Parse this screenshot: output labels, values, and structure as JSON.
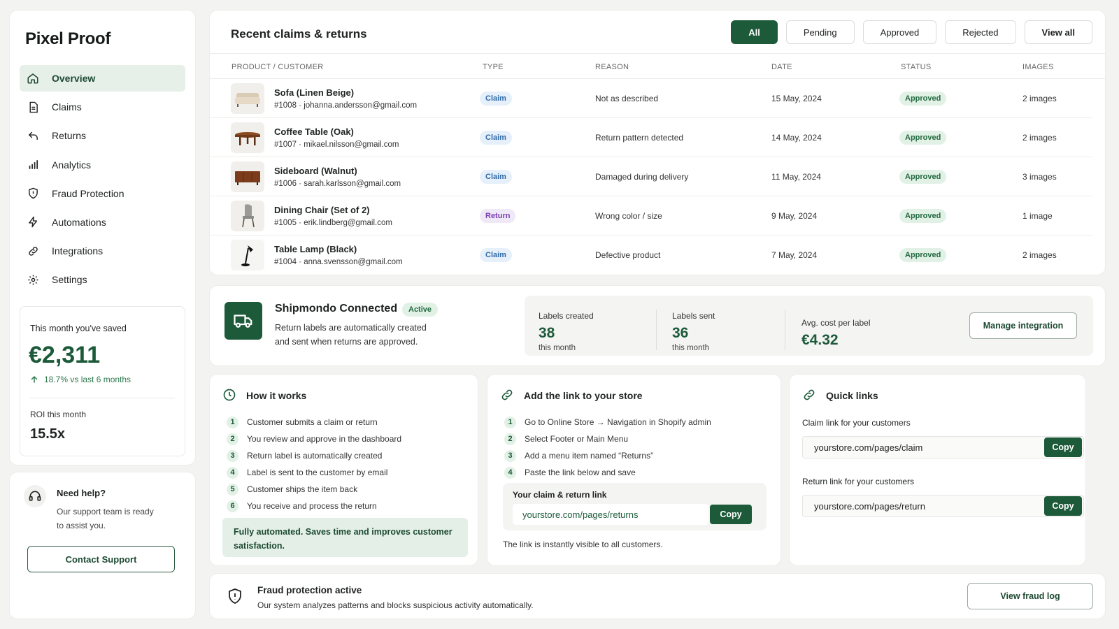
{
  "app": {
    "name": "Pixel Proof"
  },
  "sidebar": {
    "items": [
      {
        "label": "Overview",
        "icon": "home-icon"
      },
      {
        "label": "Claims",
        "icon": "document-icon"
      },
      {
        "label": "Returns",
        "icon": "return-arrow-icon"
      },
      {
        "label": "Analytics",
        "icon": "bar-chart-icon"
      },
      {
        "label": "Fraud Protection",
        "icon": "shield-icon"
      },
      {
        "label": "Automations",
        "icon": "lightning-icon"
      },
      {
        "label": "Integrations",
        "icon": "link-icon"
      },
      {
        "label": "Settings",
        "icon": "gear-icon"
      }
    ],
    "savings": {
      "label": "This month you've saved",
      "amount": "€2,311",
      "trend": "18.7% vs last 6 months",
      "roi_label": "ROI this month",
      "roi_value": "15.5x"
    },
    "help": {
      "title": "Need help?",
      "text": "Our support team is ready to assist you.",
      "button": "Contact Support"
    }
  },
  "claims": {
    "title": "Recent claims & returns",
    "filters": [
      "All",
      "Pending",
      "Approved",
      "Rejected"
    ],
    "view_all": "View all",
    "columns": [
      "Product / Customer",
      "Type",
      "Reason",
      "Date",
      "Status",
      "Images"
    ],
    "rows": [
      {
        "product": "Sofa (Linen Beige)",
        "customer": "#1008 · johanna.andersson@gmail.com",
        "type": "Claim",
        "reason": "Not as described",
        "date": "15 May, 2024",
        "status": "Approved",
        "images": "2 images"
      },
      {
        "product": "Coffee Table (Oak)",
        "customer": "#1007 · mikael.nilsson@gmail.com",
        "type": "Claim",
        "reason": "Return pattern detected",
        "date": "14 May, 2024",
        "status": "Approved",
        "images": "2 images"
      },
      {
        "product": "Sideboard (Walnut)",
        "customer": "#1006 · sarah.karlsson@gmail.com",
        "type": "Claim",
        "reason": "Damaged during delivery",
        "date": "11 May, 2024",
        "status": "Approved",
        "images": "3 images"
      },
      {
        "product": "Dining Chair (Set of 2)",
        "customer": "#1005 · erik.lindberg@gmail.com",
        "type": "Return",
        "reason": "Wrong color / size",
        "date": "9 May, 2024",
        "status": "Approved",
        "images": "1 image"
      },
      {
        "product": "Table Lamp (Black)",
        "customer": "#1004 · anna.svensson@gmail.com",
        "type": "Claim",
        "reason": "Defective product",
        "date": "7 May, 2024",
        "status": "Approved",
        "images": "2 images"
      }
    ]
  },
  "shipmondo": {
    "title": "Shipmondo Connected",
    "badge": "Active",
    "description": "Return labels are automatically created and sent when returns are approved.",
    "stats": [
      {
        "label": "Labels created",
        "value": "38",
        "sub": "this month"
      },
      {
        "label": "Labels sent",
        "value": "36",
        "sub": "this month"
      },
      {
        "label": "Avg. cost per label",
        "value": "€4.32"
      }
    ],
    "button": "Manage integration"
  },
  "how_it_works": {
    "title": "How it works",
    "steps": [
      "Customer submits a claim or return",
      "You review and approve in the dashboard",
      "Return label is automatically created",
      "Label is sent to the customer by email",
      "Customer ships the item back",
      "You receive and process the return"
    ],
    "banner": "Fully automated. Saves time and improves customer satisfaction."
  },
  "add_link": {
    "title": "Add the link to your store",
    "steps": [
      "Go to Online Store → Navigation in Shopify admin",
      "Select Footer or Main Menu",
      "Add a menu item named “Returns”",
      "Paste the link below and save"
    ],
    "box_title": "Your claim & return link",
    "link": "yourstore.com/pages/returns",
    "copy": "Copy",
    "note": "The link is instantly visible to all customers."
  },
  "quick_links": {
    "title": "Quick links",
    "claim_label": "Claim link for your customers",
    "claim_link": "yourstore.com/pages/claim",
    "return_label": "Return link for your customers",
    "return_link": "yourstore.com/pages/return",
    "copy": "Copy"
  },
  "fraud": {
    "title": "Fraud protection active",
    "description": "Our system analyzes patterns and blocks suspicious activity automatically.",
    "button": "View fraud log"
  }
}
